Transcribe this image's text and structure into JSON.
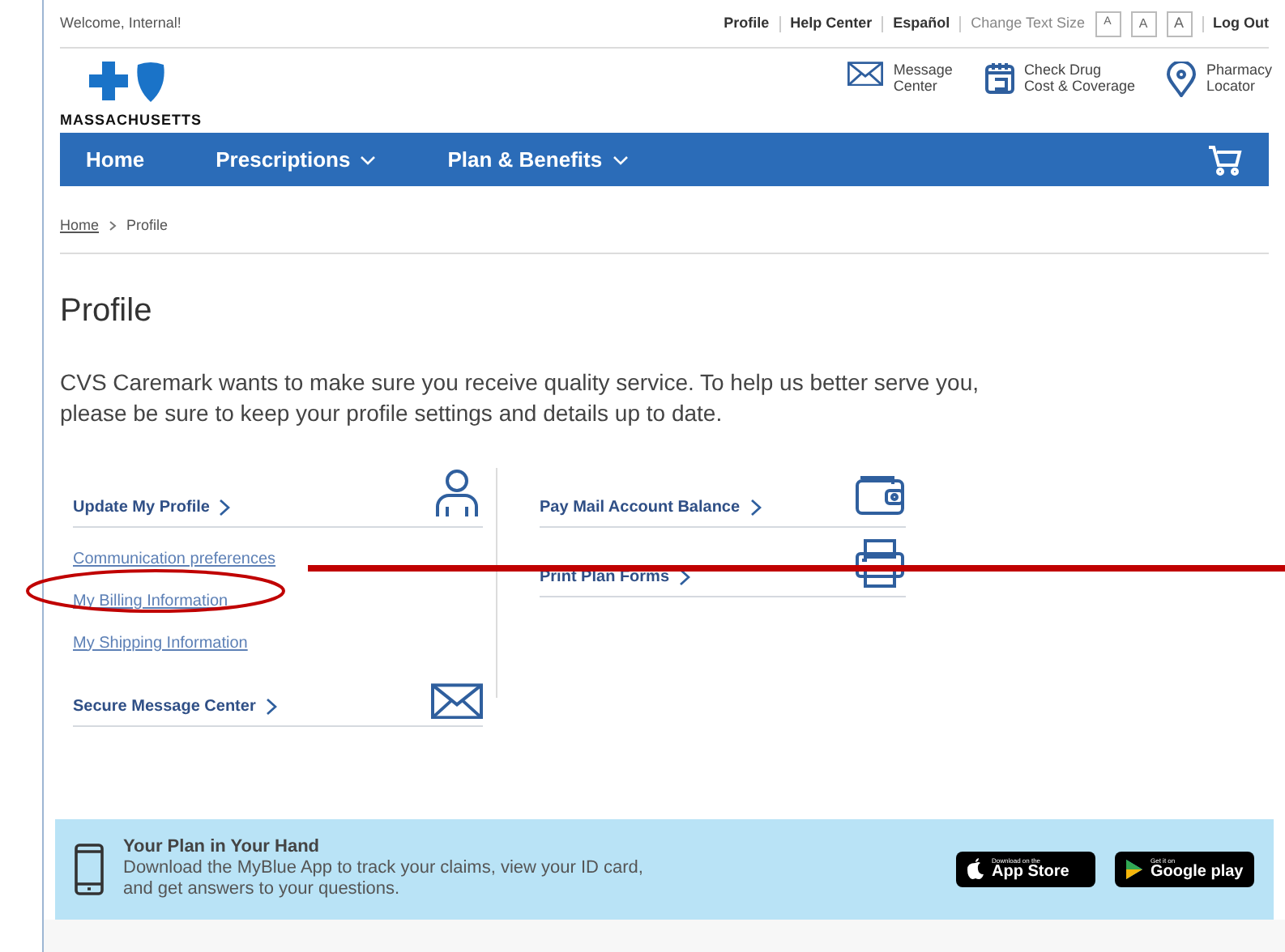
{
  "top_bar": {
    "welcome": "Welcome, Internal!",
    "links": [
      "Profile",
      "Help Center",
      "Español"
    ],
    "text_size_label": "Change Text Size",
    "text_size_buttons": [
      "A",
      "A",
      "A"
    ],
    "logout": "Log Out"
  },
  "header": {
    "logo_text": "MASSACHUSETTS",
    "quick_links": [
      {
        "kind": "envelope",
        "lines": [
          "Message",
          "Center"
        ]
      },
      {
        "kind": "calendar",
        "lines": [
          "Check Drug",
          "Cost & Coverage"
        ]
      },
      {
        "kind": "pin",
        "lines": [
          "Pharmacy",
          "Locator"
        ]
      }
    ]
  },
  "nav": {
    "items": [
      {
        "label": "Home",
        "dropdown": false
      },
      {
        "label": "Prescriptions",
        "dropdown": true
      },
      {
        "label": "Plan & Benefits",
        "dropdown": true
      }
    ]
  },
  "breadcrumb": [
    "Home",
    "Profile"
  ],
  "title": "Profile",
  "intro": "CVS Caremark wants to make sure you receive quality service. To help us better serve you, please be sure to keep your profile settings and details up to date.",
  "left_cards": [
    {
      "title": "Update My Profile",
      "kind": "person",
      "links": [
        {
          "label": "Communication preferences",
          "circled": false
        },
        {
          "label": "My Billing Information",
          "circled": true
        },
        {
          "label": "My Shipping Information",
          "circled": false
        }
      ]
    },
    {
      "title": "Secure Message Center",
      "kind": "envelope"
    }
  ],
  "right_cards": [
    {
      "title": "Pay Mail Account Balance",
      "kind": "wallet"
    },
    {
      "title": "Print Plan Forms",
      "kind": "printer"
    }
  ],
  "banner": {
    "title": "Your Plan in Your Hand",
    "text": "Download the MyBlue App to track your claims, view your ID card, and get answers to your questions.",
    "badges": [
      {
        "kind": "apple",
        "small": "Download on the",
        "big": "App Store"
      },
      {
        "kind": "google",
        "small": "Get it on",
        "big": "Google play"
      }
    ]
  }
}
